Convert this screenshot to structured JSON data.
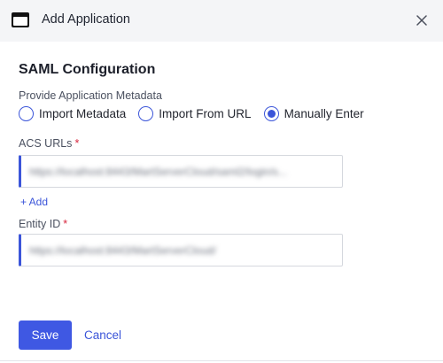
{
  "dialog": {
    "title": "Add Application",
    "icon": "window-icon",
    "close_icon": "close-icon"
  },
  "section": {
    "title": "SAML Configuration"
  },
  "metadata": {
    "label": "Provide Application Metadata",
    "options": [
      {
        "label": "Import Metadata",
        "selected": false
      },
      {
        "label": "Import From URL",
        "selected": false
      },
      {
        "label": "Manually Enter",
        "selected": true
      }
    ]
  },
  "acs_urls": {
    "label": "ACS URLs",
    "required_mark": "*",
    "value": "https://localhost:8443/MartServerCloud/saml2/login/s...",
    "add_label": "+ Add"
  },
  "entity_id": {
    "label": "Entity ID",
    "required_mark": "*",
    "value": "https://localhost:8443/MartServerCloud/"
  },
  "actions": {
    "save_label": "Save",
    "cancel_label": "Cancel"
  },
  "colors": {
    "accent": "#3b55d9",
    "primary_button": "#3f58e3",
    "required": "#d7263d",
    "header_bg": "#f4f5f7"
  }
}
